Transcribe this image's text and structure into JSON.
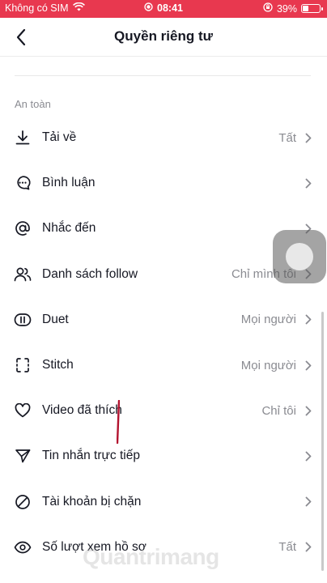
{
  "status_bar": {
    "carrier": "Không có SIM",
    "time": "08:41",
    "battery_percent": "39%",
    "battery_level": 0.39,
    "background_color": "#e8384f"
  },
  "header": {
    "title": "Quyền riêng tư",
    "back_icon": "chevron-left-icon"
  },
  "section": {
    "label": "An toàn"
  },
  "items": [
    {
      "label": "Tải về",
      "value": "Tất",
      "icon": "download-icon"
    },
    {
      "label": "Bình luận",
      "value": "",
      "icon": "comment-icon"
    },
    {
      "label": "Nhắc đến",
      "value": "",
      "icon": "at-icon"
    },
    {
      "label": "Danh sách follow",
      "value": "Chỉ mình tôi",
      "icon": "users-icon"
    },
    {
      "label": "Duet",
      "value": "Mọi người",
      "icon": "duet-icon"
    },
    {
      "label": "Stitch",
      "value": "Mọi người",
      "icon": "stitch-icon"
    },
    {
      "label": "Video đã thích",
      "value": "Chỉ tôi",
      "icon": "heart-icon"
    },
    {
      "label": "Tin nhắn trực tiếp",
      "value": "",
      "icon": "send-icon"
    },
    {
      "label": "Tài khoản bị chặn",
      "value": "",
      "icon": "block-icon"
    },
    {
      "label": "Số lượt xem hồ sơ",
      "value": "Tất",
      "icon": "eye-icon"
    }
  ],
  "watermark": "Quantrimang"
}
